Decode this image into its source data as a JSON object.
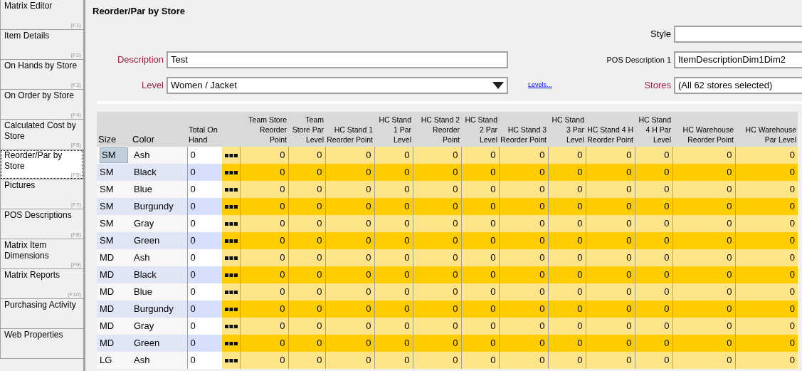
{
  "sidebar": {
    "items": [
      {
        "label": "Matrix Editor",
        "key": "(F1)",
        "selected": false
      },
      {
        "label": "Item Details",
        "key": "(F2)",
        "selected": false
      },
      {
        "label": "On Hands by Store",
        "key": "(F3)",
        "selected": false
      },
      {
        "label": "On Order by Store",
        "key": "(F4)",
        "selected": false
      },
      {
        "label": "Calculated Cost by Store",
        "key": "(F5)",
        "selected": false
      },
      {
        "label": "Reorder/Par by Store",
        "key": "(F6)",
        "selected": true
      },
      {
        "label": "Pictures",
        "key": "(F7)",
        "selected": false
      },
      {
        "label": "POS Descriptions",
        "key": "(F8)",
        "selected": false
      },
      {
        "label": "Matrix Item Dimensions",
        "key": "(F9)",
        "selected": false
      },
      {
        "label": "Matrix Reports",
        "key": "(F10)",
        "selected": false
      },
      {
        "label": "Purchasing Activity",
        "selected": false
      },
      {
        "label": "Web Properties",
        "selected": false
      }
    ]
  },
  "title": "Reorder/Par by Store",
  "form": {
    "style": {
      "label": "Style"
    },
    "description": {
      "label": "Description",
      "value": "Test"
    },
    "pos_description": {
      "label": "POS Description 1",
      "value": "ItemDescriptionDim1Dim2"
    },
    "level": {
      "label": "Level",
      "value": "Women / Jacket"
    },
    "levels_link": "Levels...",
    "stores": {
      "label": "Stores",
      "value": "(All 62 stores selected)"
    }
  },
  "table": {
    "columns": [
      "Size",
      "Color",
      "Total On Hand",
      "Team Store Reorder Point",
      "Team Store Par Level",
      "HC Stand 1 Reorder Point",
      "HC Stand 1 Par Level",
      "HC Stand 2 Reorder Point",
      "HC Stand 2 Par Level",
      "HC Stand 3 Reorder Point",
      "HC Stand 3 Par Level",
      "HC Stand 4 H Reorder Point",
      "HC Stand 4 H Par Level",
      "HC Warehouse Reorder Point",
      "HC Warehouse Par Level"
    ],
    "rows": [
      {
        "size": "SM",
        "color_name": "Ash",
        "total": "0",
        "values": [
          "0",
          "0",
          "0",
          "0",
          "0",
          "0",
          "0",
          "0",
          "0",
          "0",
          "0",
          "0"
        ],
        "selected": true
      },
      {
        "size": "SM",
        "color_name": "Black",
        "total": "0",
        "values": [
          "0",
          "0",
          "0",
          "0",
          "0",
          "0",
          "0",
          "0",
          "0",
          "0",
          "0",
          "0"
        ],
        "selected": false
      },
      {
        "size": "SM",
        "color_name": "Blue",
        "total": "0",
        "values": [
          "0",
          "0",
          "0",
          "0",
          "0",
          "0",
          "0",
          "0",
          "0",
          "0",
          "0",
          "0"
        ],
        "selected": false
      },
      {
        "size": "SM",
        "color_name": "Burgundy",
        "total": "0",
        "values": [
          "0",
          "0",
          "0",
          "0",
          "0",
          "0",
          "0",
          "0",
          "0",
          "0",
          "0",
          "0"
        ],
        "selected": false
      },
      {
        "size": "SM",
        "color_name": "Gray",
        "total": "0",
        "values": [
          "0",
          "0",
          "0",
          "0",
          "0",
          "0",
          "0",
          "0",
          "0",
          "0",
          "0",
          "0"
        ],
        "selected": false
      },
      {
        "size": "SM",
        "color_name": "Green",
        "total": "0",
        "values": [
          "0",
          "0",
          "0",
          "0",
          "0",
          "0",
          "0",
          "0",
          "0",
          "0",
          "0",
          "0"
        ],
        "selected": false
      },
      {
        "size": "MD",
        "color_name": "Ash",
        "total": "0",
        "values": [
          "0",
          "0",
          "0",
          "0",
          "0",
          "0",
          "0",
          "0",
          "0",
          "0",
          "0",
          "0"
        ],
        "selected": false
      },
      {
        "size": "MD",
        "color_name": "Black",
        "total": "0",
        "values": [
          "0",
          "0",
          "0",
          "0",
          "0",
          "0",
          "0",
          "0",
          "0",
          "0",
          "0",
          "0"
        ],
        "selected": false
      },
      {
        "size": "MD",
        "color_name": "Blue",
        "total": "0",
        "values": [
          "0",
          "0",
          "0",
          "0",
          "0",
          "0",
          "0",
          "0",
          "0",
          "0",
          "0",
          "0"
        ],
        "selected": false
      },
      {
        "size": "MD",
        "color_name": "Burgundy",
        "total": "0",
        "values": [
          "0",
          "0",
          "0",
          "0",
          "0",
          "0",
          "0",
          "0",
          "0",
          "0",
          "0",
          "0"
        ],
        "selected": false
      },
      {
        "size": "MD",
        "color_name": "Gray",
        "total": "0",
        "values": [
          "0",
          "0",
          "0",
          "0",
          "0",
          "0",
          "0",
          "0",
          "0",
          "0",
          "0",
          "0"
        ],
        "selected": false
      },
      {
        "size": "MD",
        "color_name": "Green",
        "total": "0",
        "values": [
          "0",
          "0",
          "0",
          "0",
          "0",
          "0",
          "0",
          "0",
          "0",
          "0",
          "0",
          "0"
        ],
        "selected": false
      },
      {
        "size": "LG",
        "color_name": "Ash",
        "total": "0",
        "values": [
          "0",
          "0",
          "0",
          "0",
          "0",
          "0",
          "0",
          "0",
          "0",
          "0",
          "0",
          "0"
        ],
        "selected": false
      }
    ]
  }
}
